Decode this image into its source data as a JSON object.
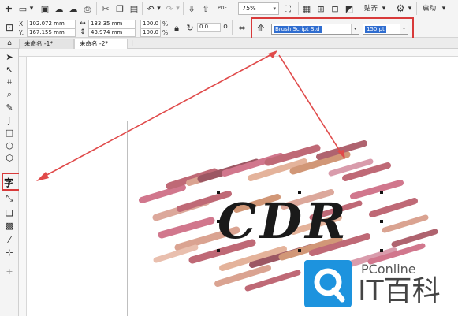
{
  "toolbar": {
    "zoom_value": "75%",
    "snap_label": "贴齐",
    "start_label": "启动"
  },
  "property_bar": {
    "x_label": "X:",
    "y_label": "Y:",
    "x_value": "102.072 mm",
    "y_value": "167.155 mm",
    "width_value": "133.35 mm",
    "height_value": "43.974 mm",
    "scale_x": "100.0",
    "scale_y": "100.0",
    "scale_unit": "%",
    "rotation_value": "0.0",
    "font_name": "Brush Script Std",
    "font_size": "150 pt",
    "bold_label": "B",
    "italic_label": "I",
    "underline_label": "U"
  },
  "tabs": [
    {
      "label": "未命名 -1*"
    },
    {
      "label": "未命名 -2*"
    }
  ],
  "toolbox": {
    "text_tool_label": "字"
  },
  "canvas": {
    "art_text": "CDR"
  },
  "watermark": {
    "top_text": "PConline",
    "main_text": "IT百科"
  },
  "colors": {
    "highlight": "#d83a3a",
    "selection_blue": "#2f6dd0",
    "logo_blue": "#1d93de"
  }
}
